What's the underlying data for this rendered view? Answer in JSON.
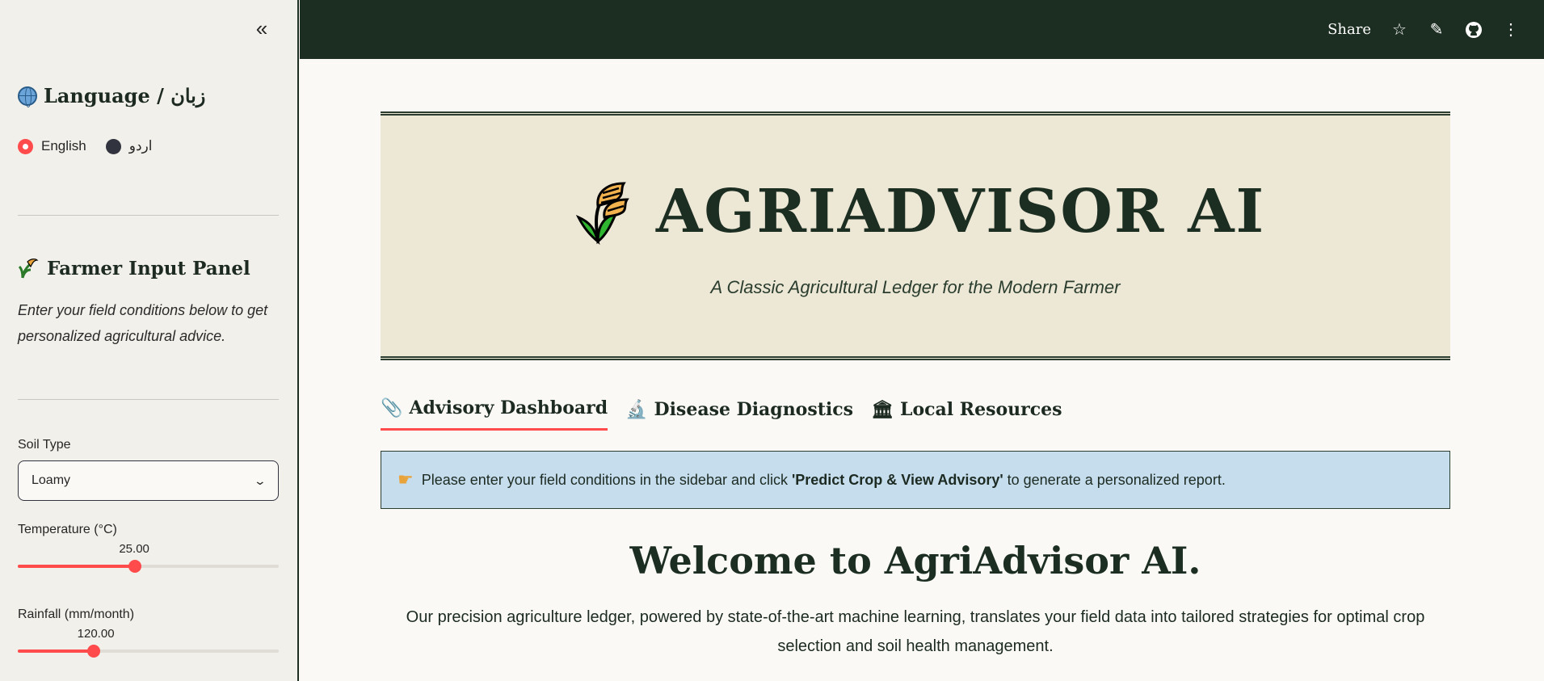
{
  "sidebar": {
    "collapse_glyph": "«",
    "language_heading": "Language / زبان",
    "language_options": [
      "English",
      "اردو"
    ],
    "language_selected": "English",
    "farmer_heading": "Farmer Input Panel",
    "farmer_desc": "Enter your field conditions below to get personalized agricultural advice.",
    "soil_label": "Soil Type",
    "soil_value": "Loamy",
    "temp_label": "Temperature (°C)",
    "temp_value": "25.00",
    "temp_fraction": 0.45,
    "rain_label": "Rainfall (mm/month)",
    "rain_value": "120.00",
    "rain_fraction": 0.29
  },
  "topbar": {
    "share_label": "Share",
    "icons": [
      "star-icon",
      "pencil-icon",
      "github-icon",
      "more-vertical-icon"
    ]
  },
  "hero": {
    "title": "AGRIADVISOR AI",
    "subtitle": "A Classic Agricultural Ledger for the Modern Farmer"
  },
  "tabs": [
    {
      "icon": "pin-icon",
      "label": "Advisory Dashboard",
      "active": true
    },
    {
      "icon": "microscope-icon",
      "label": "Disease Diagnostics",
      "active": false
    },
    {
      "icon": "bank-icon",
      "label": "Local Resources",
      "active": false
    }
  ],
  "info": {
    "prefix": "Please enter your field conditions in the sidebar and click ",
    "bold": "'Predict Crop & View Advisory'",
    "suffix": " to generate a personalized report."
  },
  "welcome": {
    "title": "Welcome to AgriAdvisor AI.",
    "body": "Our precision agriculture ledger, powered by state-of-the-art machine learning, translates your field data into tailored strategies for optimal crop selection and soil health management."
  },
  "colors": {
    "accent": "#ff4b4b",
    "header_bg": "#1c2e22",
    "hero_bg": "#ede7d6",
    "info_bg": "#c5ddec"
  }
}
